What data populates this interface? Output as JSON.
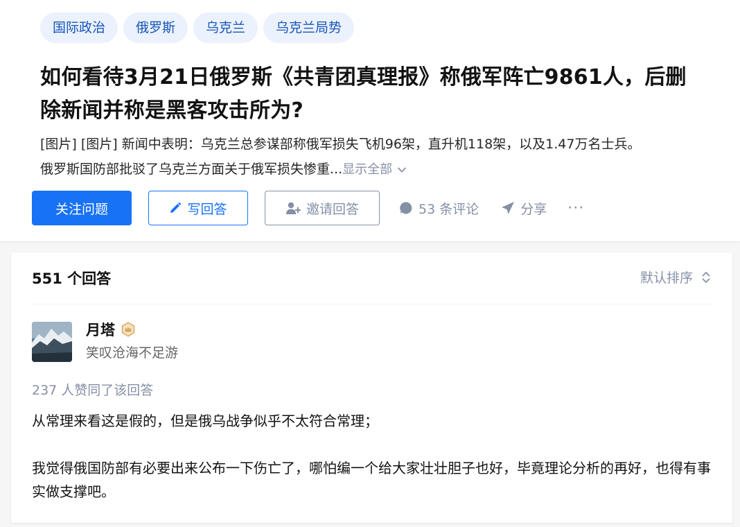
{
  "question": {
    "topics": [
      "国际政治",
      "俄罗斯",
      "乌克兰",
      "乌克兰局势"
    ],
    "title_line1": "如何看待3月21日俄罗斯《共青团真理报》称俄军阵亡9861人，后删",
    "title_line2": "除新闻并称是黑客攻击所为?",
    "excerpt_line1": "[图片] [图片] 新闻中表明：乌克兰总参谋部称俄军损失飞机96架，直升机118架，以及1.47万名士兵。",
    "excerpt_line2": "俄罗斯国防部批驳了乌克兰方面关于俄军损失惨重...",
    "show_all": "显示全部"
  },
  "actions": {
    "follow": "关注问题",
    "write": "写回答",
    "invite": "邀请回答",
    "comments": "53 条评论",
    "share": "分享",
    "more": "···"
  },
  "answers": {
    "count_label": "551 个回答",
    "sort_label": "默认排序",
    "first": {
      "author_name": "月塔",
      "author_bio": "笑叹沧海不足游",
      "votes_text": "237 人赞同了该回答",
      "paragraphs": [
        "从常理来看这是假的，但是俄乌战争似乎不太符合常理；",
        "我觉得俄国防部有必要出来公布一下伤亡了，哪怕编一个给大家壮壮胆子也好，毕竟理论分析的再好，也得有事实做支撑吧。"
      ]
    }
  },
  "colors": {
    "primary": "#1772f6",
    "topic_bg": "#ebf1fd",
    "topic_text": "#1756b8",
    "meta_gray": "#8590a6",
    "badge_gold": "#d8a55a"
  }
}
